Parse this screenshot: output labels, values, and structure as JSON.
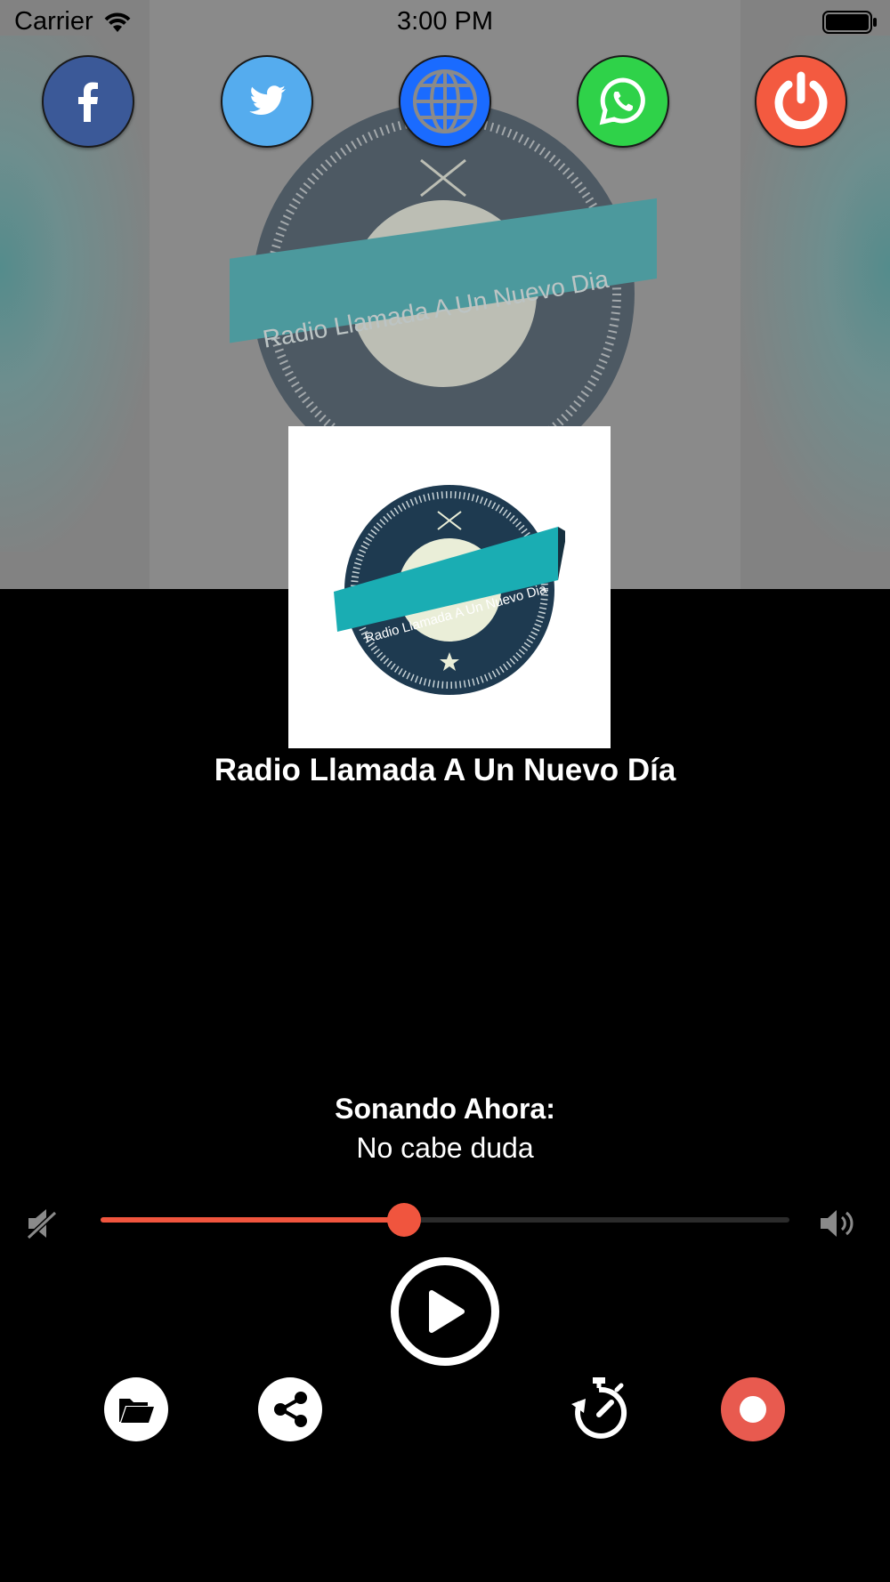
{
  "status_bar": {
    "carrier": "Carrier",
    "time": "3:00 PM"
  },
  "social": [
    {
      "name": "facebook",
      "icon": "facebook-icon",
      "color": "#3b5998"
    },
    {
      "name": "twitter",
      "icon": "twitter-icon",
      "color": "#55acee"
    },
    {
      "name": "website",
      "icon": "globe-icon",
      "color": "#1a6bff"
    },
    {
      "name": "whatsapp",
      "icon": "whatsapp-icon",
      "color": "#2fd249"
    },
    {
      "name": "power",
      "icon": "power-icon",
      "color": "#f35a40"
    }
  ],
  "logo": {
    "banner_text": "Radio Llamada A Un Nuevo Dia"
  },
  "station": {
    "title": "Radio Llamada A Un Nuevo Día"
  },
  "now_playing": {
    "label": "Sonando Ahora:",
    "track": "No cabe duda"
  },
  "volume": {
    "level": 0.44,
    "accent": "#f0553e"
  },
  "controls": {
    "play_icon": "play-icon",
    "actions": [
      "folder-icon",
      "share-icon",
      "timer-icon",
      "record-icon"
    ]
  }
}
